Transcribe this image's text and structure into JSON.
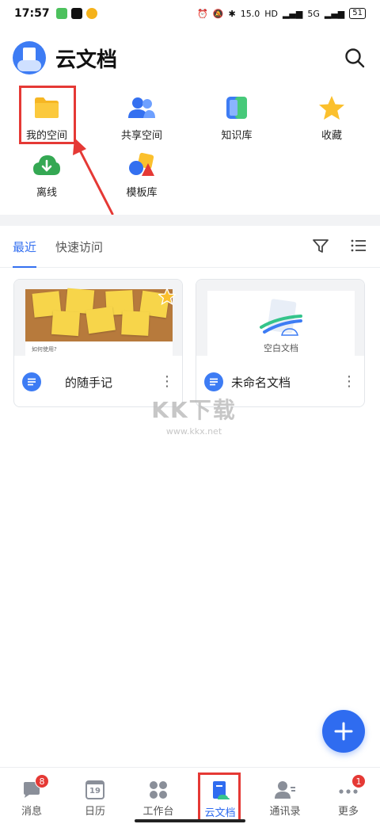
{
  "status_bar": {
    "time": "17:57",
    "speed": "15.0",
    "network": "5G",
    "battery": "51"
  },
  "header": {
    "title": "云文档"
  },
  "quick_access": [
    {
      "label": "我的空间",
      "icon": "folder-icon"
    },
    {
      "label": "共享空间",
      "icon": "people-icon"
    },
    {
      "label": "知识库",
      "icon": "knowledge-base-icon"
    },
    {
      "label": "收藏",
      "icon": "star-icon"
    },
    {
      "label": "离线",
      "icon": "download-icon"
    },
    {
      "label": "模板库",
      "icon": "template-icon"
    }
  ],
  "tabs": [
    {
      "label": "最近",
      "active": true
    },
    {
      "label": "快速访问",
      "active": false
    }
  ],
  "documents": [
    {
      "name": "的随手记",
      "thumb_caption": "如何使用?",
      "starred": true
    },
    {
      "name": "未命名文档",
      "thumb_caption": "空白文档",
      "starred": false
    }
  ],
  "watermark": {
    "logo": "KK下载",
    "url": "www.kkx.net"
  },
  "bottom_nav": [
    {
      "label": "消息",
      "icon": "message-icon",
      "badge": "8"
    },
    {
      "label": "日历",
      "icon": "calendar-icon",
      "icon_text": "19"
    },
    {
      "label": "工作台",
      "icon": "workbench-icon"
    },
    {
      "label": "云文档",
      "icon": "cloud-doc-icon",
      "active": true
    },
    {
      "label": "通讯录",
      "icon": "contacts-icon"
    },
    {
      "label": "更多",
      "icon": "more-icon",
      "badge": "1"
    }
  ],
  "colors": {
    "accent": "#2f6cf0",
    "annotation_red": "#e53935"
  }
}
